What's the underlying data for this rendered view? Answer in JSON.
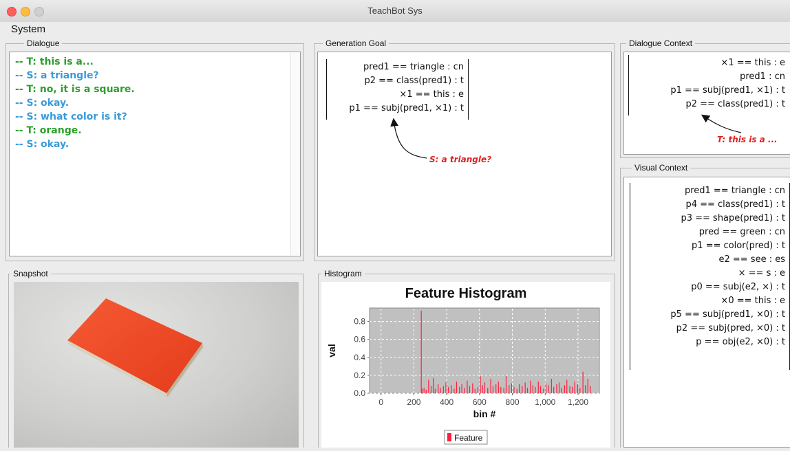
{
  "window": {
    "title": "TeachBot Sys"
  },
  "menu": {
    "items": [
      "System"
    ]
  },
  "dialogue": {
    "label": "Dialogue",
    "lines": [
      {
        "text": "-- T: this is a...",
        "color": "#2ca02c"
      },
      {
        "text": "-- S: a triangle?",
        "color": "#3a9ad9"
      },
      {
        "text": "-- T: no, it is a square.",
        "color": "#2ca02c"
      },
      {
        "text": "-- S: okay.",
        "color": "#3a9ad9"
      },
      {
        "text": "-- S: what color is it?",
        "color": "#3a9ad9"
      },
      {
        "text": "-- T: orange.",
        "color": "#2ca02c"
      },
      {
        "text": "-- S: okay.",
        "color": "#3a9ad9"
      }
    ]
  },
  "generation_goal": {
    "label": "Generation Goal",
    "lines": [
      "pred1 == triangle : cn",
      "p2 == class(pred1) : t",
      "×1 == this : e",
      "p1 == subj(pred1, ×1) : t"
    ],
    "annotation": "S: a triangle?"
  },
  "dialogue_context": {
    "label": "Dialogue Context",
    "lines": [
      "×1 == this : e",
      "pred1 : cn",
      "p1 == subj(pred1, ×1) : t",
      "p2 == class(pred1) : t"
    ],
    "annotation": "T: this is a ..."
  },
  "visual_context": {
    "label": "Visual Context",
    "lines": [
      "pred1 == triangle : cn",
      "p4 == class(pred1) : t",
      "p3 == shape(pred1) : t",
      "pred == green : cn",
      "p1 == color(pred) : t",
      "e2 == see : es",
      "× == s : e",
      "p0 == subj(e2, ×) : t",
      "×0 == this : e",
      "p5 == subj(pred1, ×0) : t",
      "p2 == subj(pred, ×0) : t",
      "p == obj(e2, ×0) : t"
    ]
  },
  "snapshot": {
    "label": "Snapshot",
    "object_color": "#f24a24"
  },
  "histogram": {
    "label": "Histogram"
  },
  "chart_data": {
    "type": "bar",
    "title": "Feature Histogram",
    "xlabel": "bin #",
    "ylabel": "val",
    "xlim": [
      -70,
      1330
    ],
    "ylim": [
      0,
      0.95
    ],
    "xticks": [
      0,
      200,
      400,
      600,
      800,
      1000,
      1200
    ],
    "xtick_labels": [
      "0",
      "200",
      "400",
      "600",
      "800",
      "1,000",
      "1,200"
    ],
    "yticks": [
      0.0,
      0.2,
      0.4,
      0.6,
      0.8
    ],
    "ytick_labels": [
      "0.0",
      "0.2",
      "0.4",
      "0.6",
      "0.8"
    ],
    "grid": true,
    "legend": "bottom-center",
    "series": [
      {
        "name": "Feature",
        "color": "#ff1f3c",
        "x": [
          245,
          250,
          262,
          275,
          290,
          305,
          318,
          330,
          348,
          362,
          380,
          395,
          410,
          428,
          445,
          460,
          478,
          492,
          510,
          525,
          540,
          558,
          572,
          590,
          605,
          618,
          632,
          650,
          668,
          682,
          700,
          715,
          730,
          748,
          762,
          780,
          795,
          810,
          828,
          842,
          860,
          878,
          892,
          910,
          925,
          940,
          958,
          972,
          990,
          1005,
          1020,
          1038,
          1052,
          1070,
          1085,
          1100,
          1118,
          1132,
          1150,
          1165,
          1180,
          1198,
          1212,
          1230,
          1245,
          1260,
          1275
        ],
        "values": [
          0.92,
          0.05,
          0.06,
          0.04,
          0.15,
          0.08,
          0.17,
          0.05,
          0.1,
          0.06,
          0.08,
          0.12,
          0.07,
          0.09,
          0.05,
          0.13,
          0.07,
          0.1,
          0.06,
          0.14,
          0.08,
          0.11,
          0.05,
          0.07,
          0.19,
          0.09,
          0.12,
          0.06,
          0.16,
          0.08,
          0.1,
          0.13,
          0.07,
          0.06,
          0.19,
          0.09,
          0.11,
          0.07,
          0.05,
          0.1,
          0.08,
          0.12,
          0.06,
          0.14,
          0.09,
          0.07,
          0.13,
          0.08,
          0.05,
          0.11,
          0.09,
          0.16,
          0.07,
          0.1,
          0.12,
          0.06,
          0.09,
          0.15,
          0.08,
          0.07,
          0.13,
          0.1,
          0.06,
          0.24,
          0.09,
          0.16,
          0.08
        ]
      }
    ]
  }
}
